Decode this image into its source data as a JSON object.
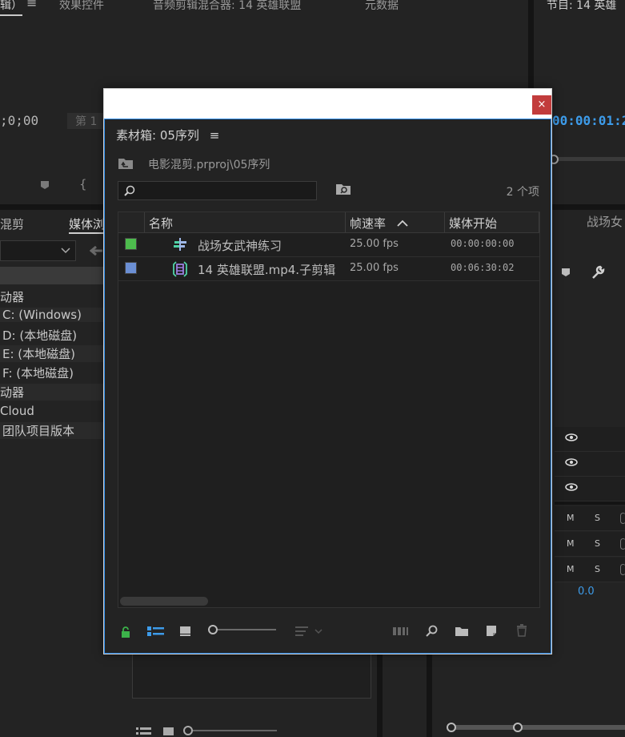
{
  "background": {
    "top_tabs": [
      "辑）",
      "效果控件",
      "音频剪辑混合器: 14 英雄联盟",
      "元数据",
      "节目: 14 英雄"
    ],
    "timecode_left": ";0;00",
    "first_label": "第 1",
    "timecode_right": "00:00:01:2",
    "left_tabs": [
      "混剪",
      "媒体浏"
    ],
    "tree": [
      "动器",
      "C: (Windows)",
      "D: (本地磁盘)",
      "E: (本地磁盘)",
      "F: (本地磁盘)",
      "动器",
      "Cloud",
      "团队项目版本"
    ],
    "right_label": "战场女",
    "track_ms": [
      "M",
      "S"
    ],
    "volume": "0.0"
  },
  "dialog": {
    "close": "×",
    "title": "素材箱: 05序列",
    "menu_icon": "≡",
    "path": "电影混剪.prproj\\05序列",
    "search_placeholder": "",
    "count": "2 个项",
    "columns": {
      "name": "名称",
      "fps": "帧速率",
      "start": "媒体开始"
    },
    "sort_icon": "chevron-up-icon",
    "rows": [
      {
        "color": "#4dbb4d",
        "icon": "sequence-icon",
        "name": "战场女武神练习",
        "fps": "25.00 fps",
        "start": "00:00:00:00"
      },
      {
        "color": "#6b8fd4",
        "icon": "subclip-icon",
        "name": "14 英雄联盟.mp4.子剪辑",
        "fps": "25.00 fps",
        "start": "00:06:30:02"
      }
    ],
    "colors": {
      "accent": "#2d8ceb",
      "lock": "#3cb34a",
      "list_view": "#3d9be9"
    }
  }
}
